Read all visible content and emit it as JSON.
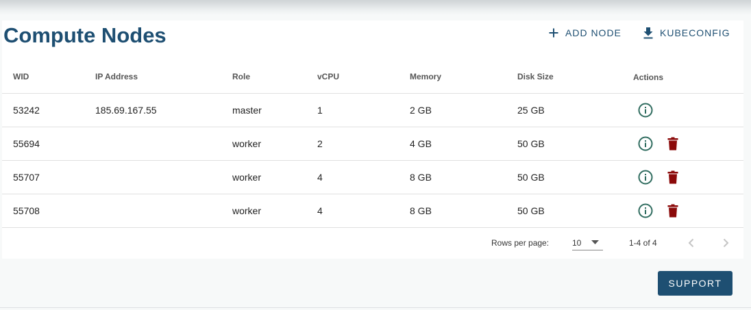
{
  "header": {
    "title": "Compute Nodes",
    "add_node_label": "ADD NODE",
    "kubeconfig_label": "KUBECONFIG"
  },
  "table": {
    "columns": [
      "WID",
      "IP Address",
      "Role",
      "vCPU",
      "Memory",
      "Disk Size",
      "Actions"
    ],
    "rows": [
      {
        "wid": "53242",
        "ip": "185.69.167.55",
        "role": "master",
        "vcpu": "1",
        "memory": "2 GB",
        "disk": "25 GB",
        "deletable": false
      },
      {
        "wid": "55694",
        "ip": "",
        "role": "worker",
        "vcpu": "2",
        "memory": "4 GB",
        "disk": "50 GB",
        "deletable": true
      },
      {
        "wid": "55707",
        "ip": "",
        "role": "worker",
        "vcpu": "4",
        "memory": "8 GB",
        "disk": "50 GB",
        "deletable": true
      },
      {
        "wid": "55708",
        "ip": "",
        "role": "worker",
        "vcpu": "4",
        "memory": "8 GB",
        "disk": "50 GB",
        "deletable": true
      }
    ]
  },
  "pagination": {
    "rows_per_page_label": "Rows per page:",
    "rows_per_page_value": "10",
    "range_text": "1-4 of 4"
  },
  "footer": {
    "support_label": "SUPPORT"
  },
  "colors": {
    "primary": "#1e4f72",
    "info_icon": "#2e6b5e",
    "delete_icon": "#8b0a0a"
  },
  "icons": {
    "add": "plus-icon",
    "kubeconfig": "download-icon",
    "info": "info-circle-icon",
    "delete": "trash-icon",
    "dropdown": "caret-down-icon",
    "prev": "chevron-left-icon",
    "next": "chevron-right-icon"
  }
}
